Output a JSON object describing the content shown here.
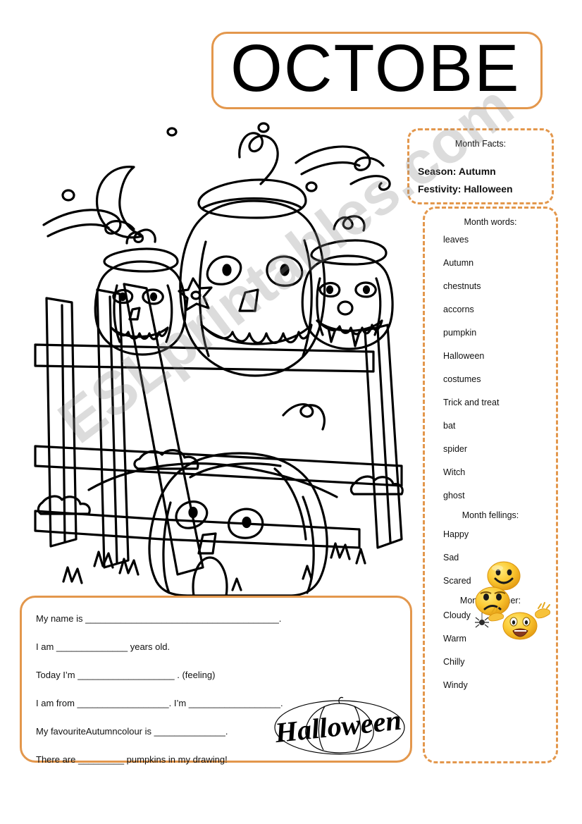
{
  "page": {
    "title": "OCTOBE",
    "accent_color": "#E3974C",
    "background_color": "#FFFFFF",
    "watermark": "ESLprintables.com"
  },
  "facts_panel": {
    "heading": "Month Facts:",
    "season": "Season: Autumn",
    "festivity": "Festivity: Halloween"
  },
  "words_panel": {
    "words_heading": "Month words:",
    "words": [
      "leaves",
      "Autumn",
      "chestnuts",
      "accorns",
      "pumpkin",
      "Halloween",
      "costumes",
      "Trick and treat",
      "bat",
      "spider",
      "Witch",
      "ghost"
    ],
    "feelings_heading": "Month fellings:",
    "feelings": [
      "Happy",
      "Sad",
      "Scared"
    ],
    "weather_heading": "Month weather:",
    "weather": [
      "Cloudy",
      "Warm",
      "Chilly",
      "Windy"
    ]
  },
  "emojis": [
    "happy-face-emoji",
    "sad-face-emoji",
    "scared-face-emoji",
    "spider-icon"
  ],
  "form": {
    "lines": [
      "My name is ______________________________________.",
      "I am ______________ years old.",
      "Today I’m ___________________ . (feeling)",
      "I am from __________________. I’m __________________.",
      "My favouriteAutumncolour is ______________.",
      "There are _________ pumpkins in my drawing!"
    ],
    "logo_text": "Halloween"
  },
  "illustration": {
    "name": "halloween-pumpkins-coloring-drawing",
    "elements": [
      "crescent-moon",
      "star",
      "wind-swirls",
      "dots",
      "jack-o-lantern",
      "wooden-fence",
      "grass",
      "hills"
    ]
  }
}
